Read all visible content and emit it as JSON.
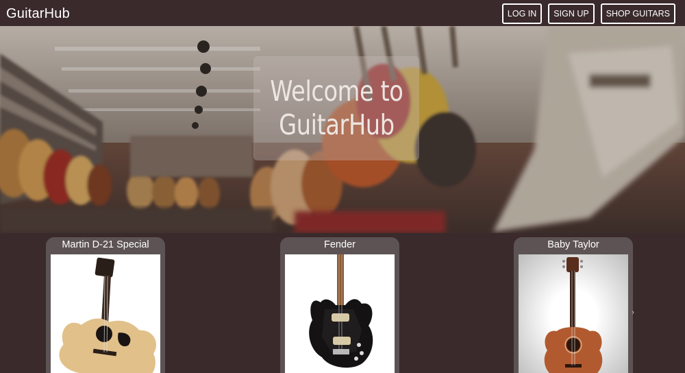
{
  "navbar": {
    "brand": "GuitarHub",
    "buttons": [
      {
        "label": "LOG IN"
      },
      {
        "label": "SIGN UP"
      },
      {
        "label": "SHOP GUITARS"
      }
    ]
  },
  "hero": {
    "title_line1": "Welcome to",
    "title_line2": "GuitarHub"
  },
  "carousel": {
    "prev_icon": "‹",
    "next_icon": "›",
    "cards": [
      {
        "title": "Martin D-21 Special",
        "image": "acoustic-guitar"
      },
      {
        "title": "Fender",
        "image": "electric-guitar"
      },
      {
        "title": "Baby Taylor",
        "image": "mahogany-acoustic-guitar"
      }
    ]
  },
  "colors": {
    "background": "#3a2a2c",
    "card": "#5d5354",
    "button_border": "#ffffff"
  }
}
